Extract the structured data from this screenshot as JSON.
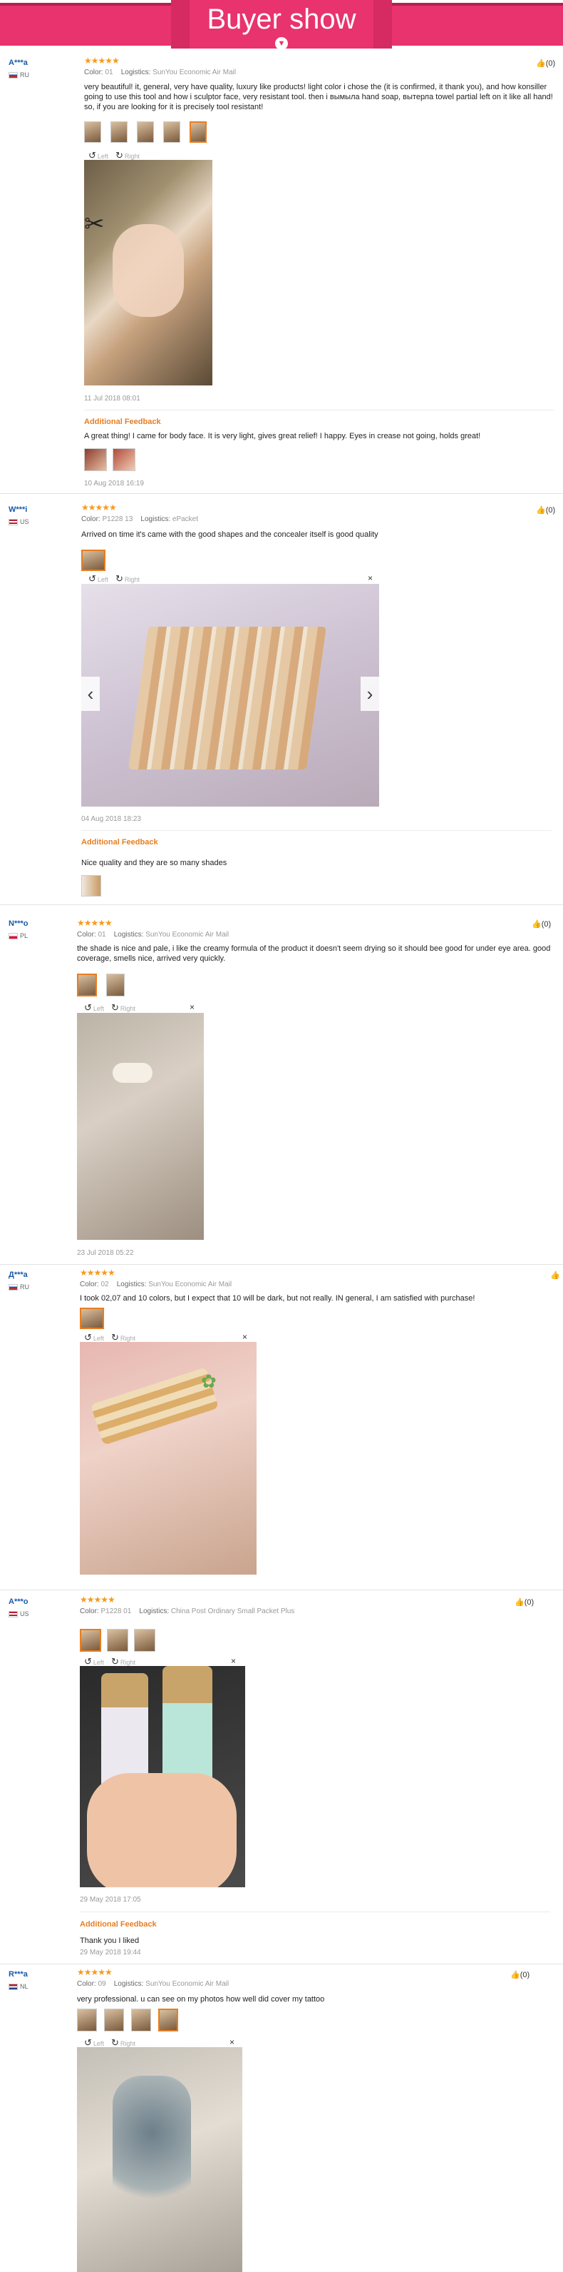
{
  "banner": {
    "title": "Buyer show"
  },
  "labels": {
    "color": "Color:",
    "logistics": "Logistics:",
    "additional_feedback": "Additional Feedback",
    "rotate_left": "Left",
    "rotate_right": "Right",
    "close": "×"
  },
  "reviews": [
    {
      "user": "A***a",
      "country": "RU",
      "flag_colors": [
        "#ffffff",
        "#1f4fb5",
        "#d52b1e"
      ],
      "color": "01",
      "logistics": "SunYou Economic Air Mail",
      "text": "very beautiful! it, general, very have quality, luxury like products! light color i chose the (it is confirmed, it thank you), and how konsiller going to use this tool and how i sculptor face, very resistant tool. then i вымыла hand soap, вытерла towel partial left on it like all hand! so, if you are looking for it is precisely tool resistant!",
      "likes": "(0)",
      "date": "11 Jul 2018 08:01",
      "additional_text": "A great thing! I came for body face. It is very light, gives great relief! I happy. Eyes in crease not going, holds great!",
      "additional_date": "10 Aug 2018 16:19"
    },
    {
      "user": "W***i",
      "country": "US",
      "flag_colors": [
        "#b22234",
        "#ffffff",
        "#3c3b6e"
      ],
      "color": "P1228 13",
      "logistics": "ePacket",
      "text": "Arrived on time it's came with the good shapes and the concealer itself is good quality",
      "likes": "(0)",
      "date": "04 Aug 2018 18:23",
      "additional_text": "Nice quality and they are so many shades"
    },
    {
      "user": "N***o",
      "country": "PL",
      "flag_colors": [
        "#ffffff",
        "#ffffff",
        "#dc143c"
      ],
      "color": "01",
      "logistics": "SunYou Economic Air Mail",
      "text": "the shade is nice and pale, i like the creamy formula of the product it doesn't seem drying so it should bee good for under eye area. good coverage, smells nice, arrived very quickly.",
      "likes": "(0)",
      "date": "23 Jul 2018 05:22"
    },
    {
      "user": "Д***а",
      "country": "RU",
      "flag_colors": [
        "#ffffff",
        "#1f4fb5",
        "#d52b1e"
      ],
      "color": "02",
      "logistics": "SunYou Economic Air Mail",
      "text": "I took 02,07 and 10 colors, but I expect that 10 will be dark, but not really. IN general, I am satisfied with purchase!"
    },
    {
      "user": "A***o",
      "country": "US",
      "flag_colors": [
        "#b22234",
        "#ffffff",
        "#3c3b6e"
      ],
      "color": "P1228 01",
      "logistics": "China Post Ordinary Small Packet Plus",
      "likes": "(0)",
      "date": "29 May 2018 17:05",
      "additional_text": "Thank you I liked",
      "additional_date": "29 May 2018 19:44"
    },
    {
      "user": "R***a",
      "country": "NL",
      "flag_colors": [
        "#ae1c28",
        "#ffffff",
        "#21468b"
      ],
      "color": "09",
      "logistics": "SunYou Economic Air Mail",
      "text": "very professional. u can see on my photos how well did cover my tattoo",
      "likes": "(0)"
    }
  ]
}
